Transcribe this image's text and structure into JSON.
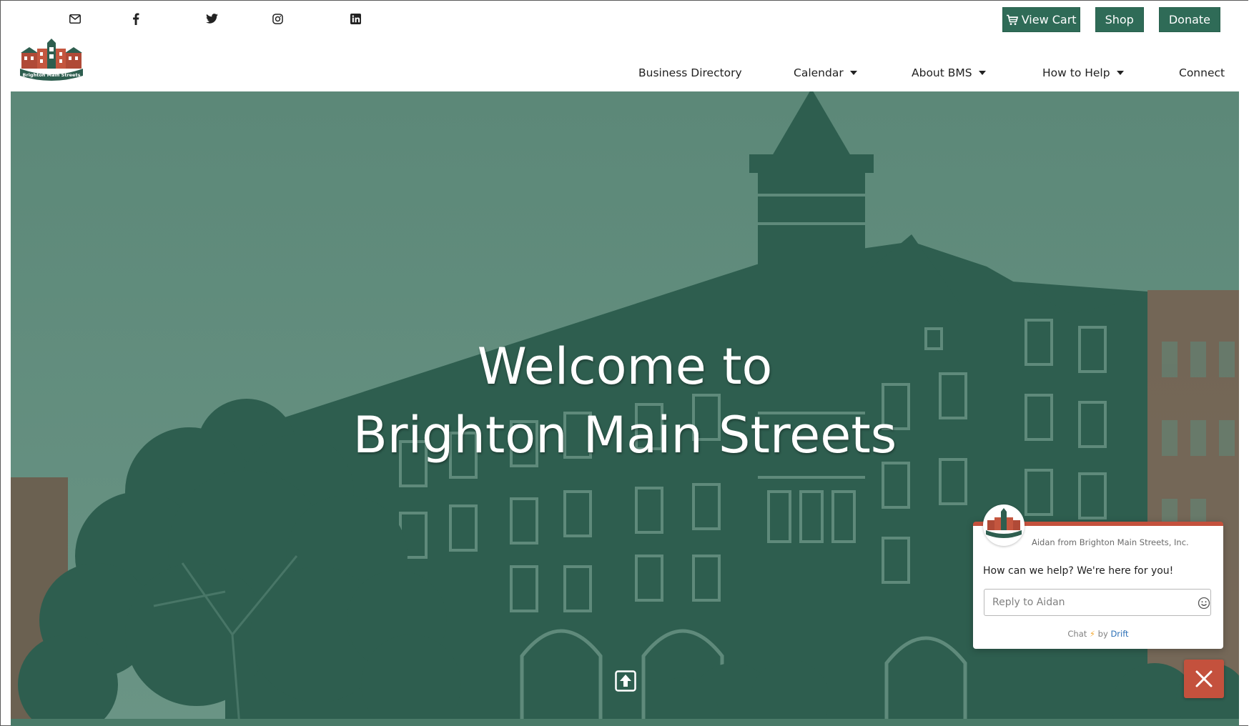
{
  "social": {
    "icons": [
      "email-icon",
      "facebook-icon",
      "twitter-icon",
      "instagram-icon",
      "linkedin-icon"
    ]
  },
  "top_buttons": {
    "view_cart": "View Cart",
    "shop": "Shop",
    "donate": "Donate"
  },
  "logo": {
    "text": "Brighton Main Streets"
  },
  "nav": {
    "items": [
      {
        "label": "Business Directory",
        "dropdown": false
      },
      {
        "label": "Calendar",
        "dropdown": true
      },
      {
        "label": "About BMS",
        "dropdown": true
      },
      {
        "label": "How to Help",
        "dropdown": true
      },
      {
        "label": "Connect",
        "dropdown": false
      }
    ]
  },
  "hero": {
    "line1": "Welcome to",
    "line2": "Brighton Main Streets"
  },
  "chat": {
    "from": "Aidan from Brighton Main Streets, Inc.",
    "message": "How can we help? We're here for you!",
    "placeholder": "Reply to Aidan",
    "footer_chat": "Chat",
    "footer_by": "by",
    "footer_brand": "Drift"
  },
  "colors": {
    "brand_green": "#2f6b57",
    "hero_bg": "#5f8a7b",
    "building": "#2e5e4f",
    "accent_red": "#c4513d"
  }
}
